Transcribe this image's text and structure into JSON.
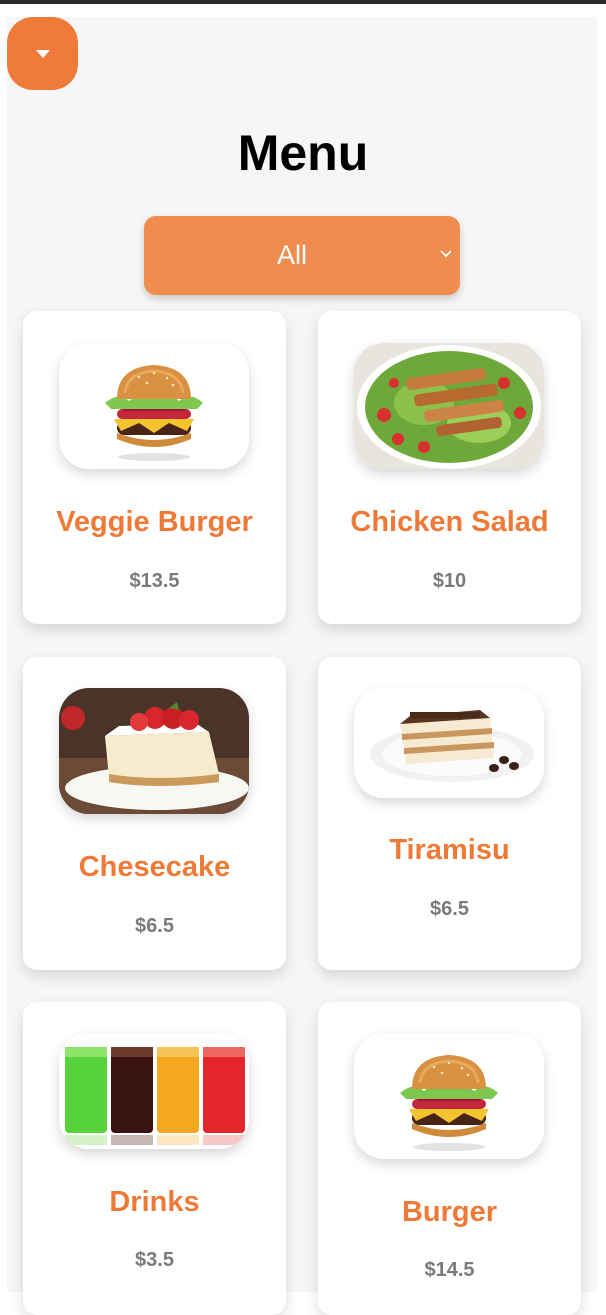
{
  "toggle": {
    "icon": "caret-down-icon"
  },
  "title": "Menu",
  "filter": {
    "selected": "All",
    "icon": "chevron-down-icon"
  },
  "colors": {
    "accent": "#f07b38",
    "select": "#f08c4e",
    "name": "#ef7a37",
    "price": "#7a7a7a"
  },
  "items": [
    {
      "name": "Veggie Burger",
      "price": "$13.5",
      "image": "burger"
    },
    {
      "name": "Chicken Salad",
      "price": "$10",
      "image": "chicken-salad"
    },
    {
      "name": "Chesecake",
      "price": "$6.5",
      "image": "cheesecake"
    },
    {
      "name": "Tiramisu",
      "price": "$6.5",
      "image": "tiramisu"
    },
    {
      "name": "Drinks",
      "price": "$3.5",
      "image": "drinks"
    },
    {
      "name": "Burger",
      "price": "$14.5",
      "image": "burger"
    }
  ]
}
